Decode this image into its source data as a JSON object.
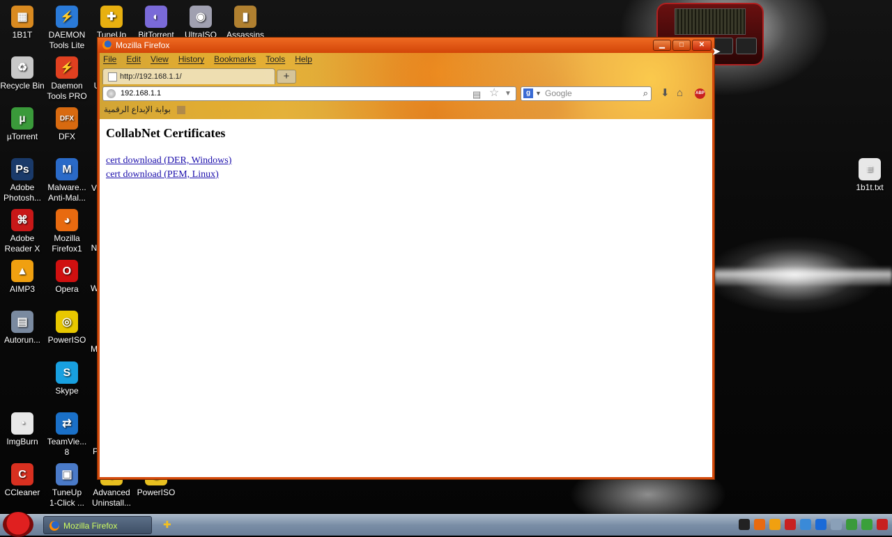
{
  "desktop": {
    "icons": [
      {
        "label": "1B1T",
        "icon": "folder-app-icon",
        "color": "#d98a20",
        "glyph": "▦"
      },
      {
        "label": "DAEMON\nTools Lite",
        "icon": "lightning-icon",
        "color": "#2a7ad8",
        "glyph": "⚡"
      },
      {
        "label": "TuneUp",
        "icon": "tuneup-icon",
        "color": "#e8b010",
        "glyph": "✚"
      },
      {
        "label": "BitTorrent",
        "icon": "bittorrent-icon",
        "color": "#7a6ad8",
        "glyph": "◐"
      },
      {
        "label": "UltraISO",
        "icon": "disc-icon",
        "color": "#a0a0b0",
        "glyph": "◉"
      },
      {
        "label": "Assassins",
        "icon": "game-icon",
        "color": "#b08030",
        "glyph": "▮"
      },
      {
        "label": "Recycle Bin",
        "icon": "recycle-bin-icon",
        "color": "#c8c8c8",
        "glyph": "♻"
      },
      {
        "label": "Daemon\nTools PRO",
        "icon": "lightning-icon",
        "color": "#e04020",
        "glyph": "⚡"
      },
      {
        "label": "µTorrent",
        "icon": "utorrent-icon",
        "color": "#3a9a3a",
        "glyph": "µ"
      },
      {
        "label": "DFX",
        "icon": "dfx-icon",
        "color": "#d86a10",
        "glyph": "DFX"
      },
      {
        "label": "Adobe\nPhotosh...",
        "icon": "photoshop-icon",
        "color": "#1a3a6a",
        "glyph": "Ps"
      },
      {
        "label": "Malware...\nAnti-Mal...",
        "icon": "malwarebytes-icon",
        "color": "#2a6ac8",
        "glyph": "M"
      },
      {
        "label": "Adobe\nReader X",
        "icon": "pdf-icon",
        "color": "#c81818",
        "glyph": "⌘"
      },
      {
        "label": "Mozilla\nFirefox1",
        "icon": "firefox-icon",
        "color": "#e86a10",
        "glyph": "◕"
      },
      {
        "label": "AIMP3",
        "icon": "aimp-icon",
        "color": "#f0a010",
        "glyph": "▲"
      },
      {
        "label": "Opera",
        "icon": "opera-icon",
        "color": "#d01010",
        "glyph": "O"
      },
      {
        "label": "Autorun...",
        "icon": "autoruns-icon",
        "color": "#7a8aa0",
        "glyph": "▤"
      },
      {
        "label": "PowerISO",
        "icon": "poweriso-icon",
        "color": "#e8c800",
        "glyph": "◎"
      },
      {
        "label": "Skype",
        "icon": "skype-icon",
        "color": "#18a0e0",
        "glyph": "S"
      },
      {
        "label": "ImgBurn",
        "icon": "imgburn-icon",
        "color": "#e8e8e8",
        "glyph": "◔"
      },
      {
        "label": "TeamVie...\n8",
        "icon": "teamviewer-icon",
        "color": "#1a70c8",
        "glyph": "⇄"
      },
      {
        "label": "CCleaner",
        "icon": "ccleaner-icon",
        "color": "#d83020",
        "glyph": "C"
      },
      {
        "label": "TuneUp\n1-Click ...",
        "icon": "tuneup-oneclick-icon",
        "color": "#4a7ac8",
        "glyph": "▣"
      },
      {
        "label": "Advanced\nUninstall...",
        "icon": "uninstaller-icon",
        "color": "#e8c020",
        "glyph": "◆"
      },
      {
        "label": "PowerISO",
        "icon": "poweriso-icon",
        "color": "#e8c020",
        "glyph": "◎"
      },
      {
        "label": "1b1t.txt",
        "icon": "text-file-icon",
        "color": "#e8e8e8",
        "glyph": "≡"
      }
    ],
    "partial_labels": [
      "U",
      "V",
      "N",
      "W",
      "M",
      "P"
    ]
  },
  "firefox": {
    "title": "Mozilla Firefox",
    "menu": [
      "File",
      "Edit",
      "View",
      "History",
      "Bookmarks",
      "Tools",
      "Help"
    ],
    "tab_label": "http://192.168.1.1/",
    "new_tab": "+",
    "url": "192.168.1.1",
    "search_placeholder": "Google",
    "bookmark": "بوابة الإبداع الرقمية",
    "window_buttons": {
      "minimize": "▁",
      "maximize": "□",
      "close": "✕"
    }
  },
  "page": {
    "heading": "CollabNet Certificates",
    "links": [
      "cert download (DER, Windows)",
      "cert download (PEM, Linux)"
    ]
  },
  "taskbar": {
    "active_task": "Mozilla Firefox",
    "tray_colors": [
      "#222",
      "#e86a10",
      "#f0a010",
      "#c82020",
      "#3a8ad8",
      "#1a6ad8",
      "#8aa0b8",
      "#3a9a3a",
      "#3aa03a",
      "#c82020"
    ]
  }
}
